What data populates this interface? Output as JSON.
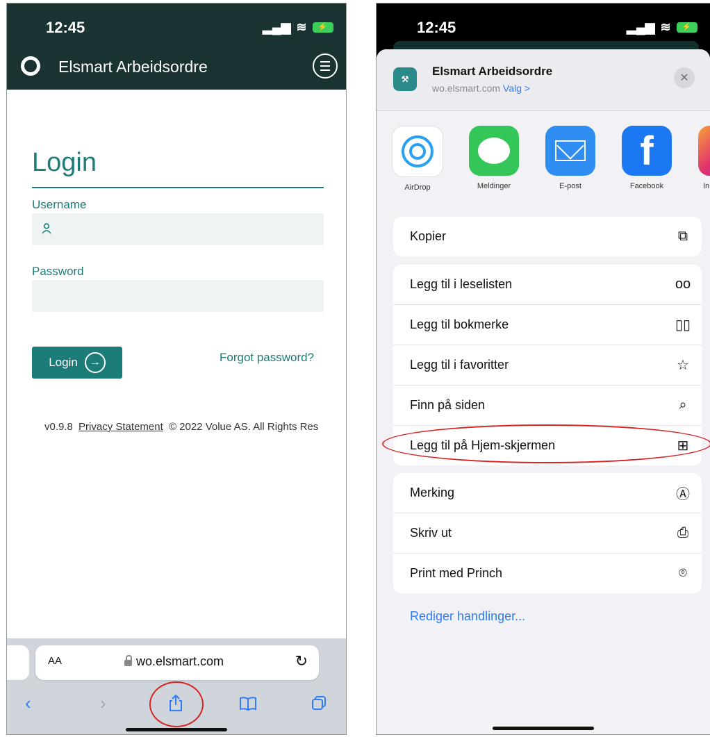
{
  "left_phone": {
    "status": {
      "time": "12:45"
    },
    "header": {
      "title": "Elsmart Arbeidsordre"
    },
    "login": {
      "title": "Login",
      "username_label": "Username",
      "password_label": "Password",
      "button_label": "Login",
      "forgot": "Forgot password?"
    },
    "footer": {
      "version": "v0.9.8",
      "privacy": "Privacy Statement",
      "copyright": "© 2022 Volue AS. All Rights Res"
    },
    "browser": {
      "aa": "AA",
      "url": "wo.elsmart.com"
    }
  },
  "right_phone": {
    "status": {
      "time": "12:45"
    },
    "sheet": {
      "title": "Elsmart Arbeidsordre",
      "subtitle": "wo.elsmart.com",
      "options_link": "Valg >",
      "apps": [
        {
          "label": "AirDrop",
          "icon": "airdrop-icon"
        },
        {
          "label": "Meldinger",
          "icon": "messages-icon"
        },
        {
          "label": "E-post",
          "icon": "mail-icon"
        },
        {
          "label": "Facebook",
          "icon": "facebook-icon"
        },
        {
          "label": "In",
          "icon": "instagram-icon"
        }
      ],
      "group1": [
        {
          "label": "Kopier",
          "icon": "copy-icon"
        }
      ],
      "group2": [
        {
          "label": "Legg til i leselisten",
          "icon": "glasses-icon"
        },
        {
          "label": "Legg til bokmerke",
          "icon": "book-icon"
        },
        {
          "label": "Legg til i favoritter",
          "icon": "star-icon"
        },
        {
          "label": "Finn på siden",
          "icon": "find-in-page-icon"
        },
        {
          "label": "Legg til på Hjem-skjermen",
          "icon": "add-square-icon"
        }
      ],
      "group3": [
        {
          "label": "Merking",
          "icon": "markup-icon"
        },
        {
          "label": "Skriv ut",
          "icon": "printer-icon"
        },
        {
          "label": "Print med Princh",
          "icon": "location-pin-icon"
        }
      ],
      "edit_actions": "Rediger handlinger..."
    }
  }
}
